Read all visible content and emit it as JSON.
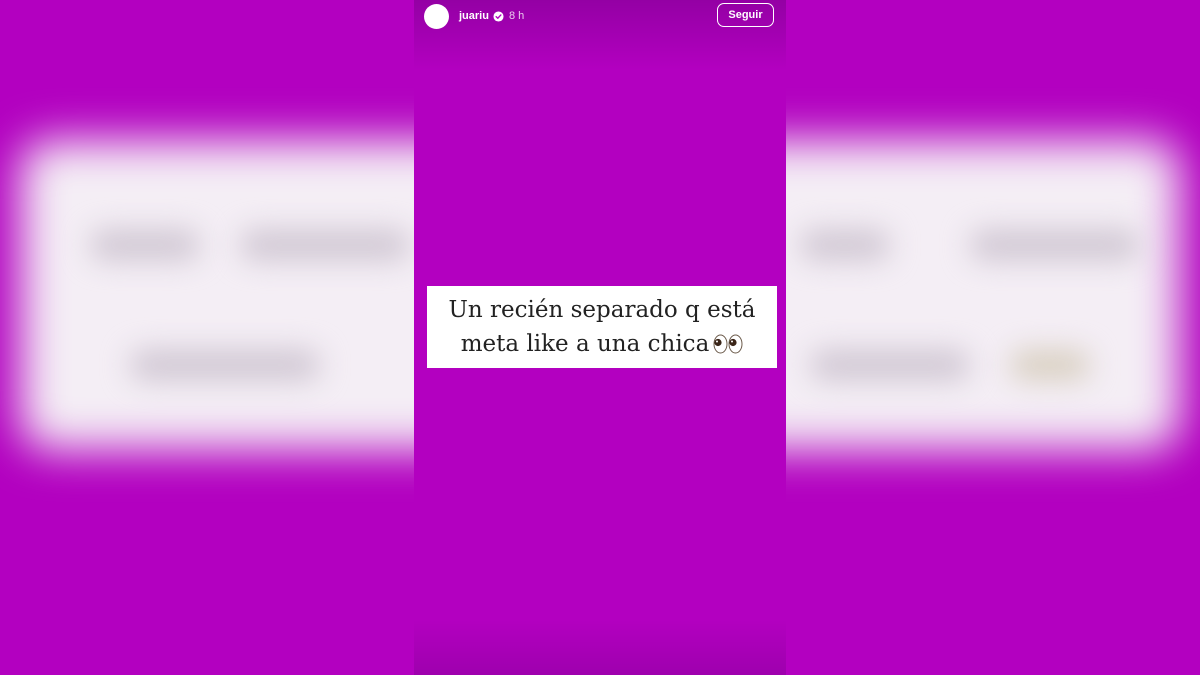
{
  "story": {
    "username": "juariu",
    "timestamp": "8 h",
    "follow_label": "Seguir",
    "caption": {
      "line1": "Un recién separado q está",
      "line2": "meta like a una chica"
    },
    "icons": {
      "verified": "verified-badge-icon",
      "more": "more-options-icon",
      "emoji": "eyes-emoji"
    }
  },
  "colors": {
    "background": "#b300c0",
    "caption_bg": "#ffffff",
    "caption_text": "#222222",
    "header_text": "#ffffff"
  }
}
